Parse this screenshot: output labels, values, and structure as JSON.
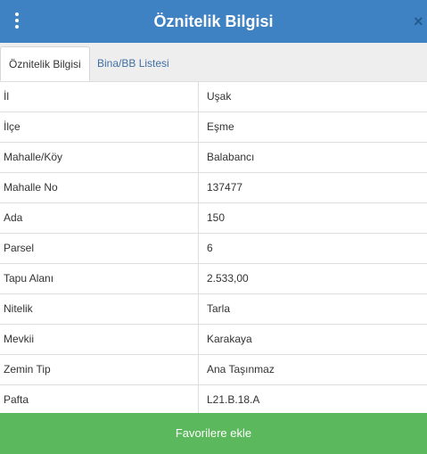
{
  "header": {
    "title": "Öznitelik Bilgisi",
    "menu_icon": "vertical-dots-icon",
    "close_icon": "close-icon",
    "close_glyph": "×"
  },
  "tabs": [
    {
      "label": "Öznitelik Bilgisi",
      "active": true
    },
    {
      "label": "Bina/BB Listesi",
      "active": false
    }
  ],
  "rows": [
    {
      "label": "İl",
      "value": "Uşak"
    },
    {
      "label": "İlçe",
      "value": "Eşme"
    },
    {
      "label": "Mahalle/Köy",
      "value": "Balabancı"
    },
    {
      "label": "Mahalle No",
      "value": "137477"
    },
    {
      "label": "Ada",
      "value": "150"
    },
    {
      "label": "Parsel",
      "value": "6"
    },
    {
      "label": "Tapu Alanı",
      "value": "2.533,00"
    },
    {
      "label": "Nitelik",
      "value": "Tarla"
    },
    {
      "label": "Mevkii",
      "value": "Karakaya"
    },
    {
      "label": "Zemin Tip",
      "value": "Ana Taşınmaz"
    },
    {
      "label": "Pafta",
      "value": "L21.B.18.A"
    }
  ],
  "footer": {
    "button_label": "Favorilere ekle"
  },
  "colors": {
    "header_bg": "#3f82c4",
    "footer_bg": "#5cb85c",
    "tab_link": "#3f6fa4"
  }
}
